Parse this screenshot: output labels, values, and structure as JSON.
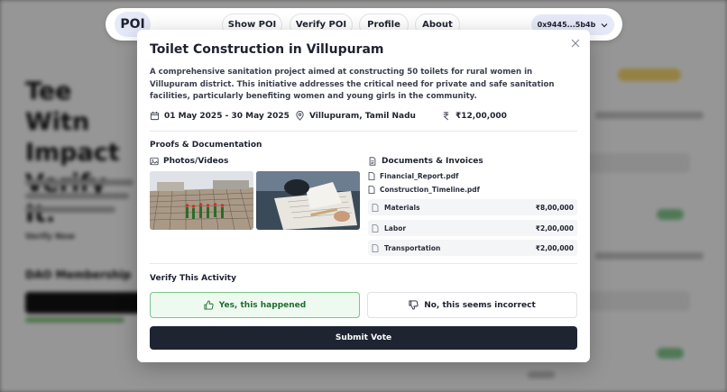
{
  "nav": {
    "logo": "POI",
    "items": [
      "Show POI",
      "Verify POI",
      "Profile",
      "About"
    ],
    "wallet": "0x9445...5b4b"
  },
  "modal": {
    "title": "Toilet Construction in Villupuram",
    "description": "A comprehensive sanitation project aimed at constructing 50 toilets for rural women in Villupuram district. This initiative addresses the critical need for private and safe sanitation facilities, particularly benefiting women and young girls in the community.",
    "date_range": "01 May 2025 - 30 May 2025",
    "location": "Villupuram, Tamil Nadu",
    "amount": "₹12,00,000",
    "proofs_title": "Proofs & Documentation",
    "photos_title": "Photos/Videos",
    "documents_title": "Documents & Invoices",
    "documents": [
      "Financial_Report.pdf",
      "Construction_Timeline.pdf"
    ],
    "costs": [
      {
        "label": "Materials",
        "amount": "₹8,00,000"
      },
      {
        "label": "Labor",
        "amount": "₹2,00,000"
      },
      {
        "label": "Transportation",
        "amount": "₹2,00,000"
      }
    ],
    "verify_title": "Verify This Activity",
    "yes_label": "Yes, this happened",
    "no_label": "No, this seems incorrect",
    "submit_label": "Submit Vote"
  },
  "background": {
    "hero": "Tee Witn Impact Verify It.",
    "dao_title": "DAO Membership",
    "verify_link": "Verify Now"
  },
  "colors": {
    "primary_dark": "#1f2432",
    "yes_green": "#1f6b33",
    "yes_bg": "#eefaf0",
    "wallet_bg": "#e6e9f8"
  }
}
